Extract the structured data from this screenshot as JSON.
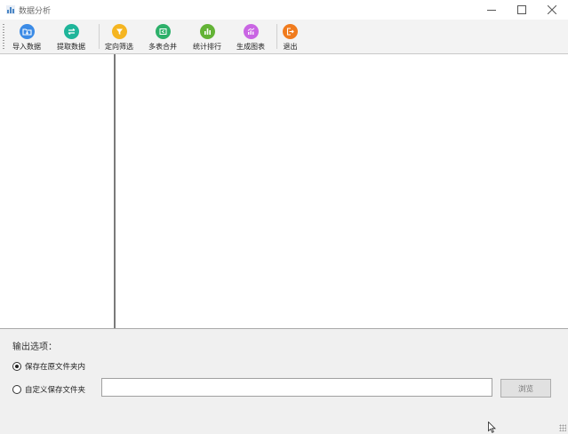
{
  "window": {
    "title": "数据分析",
    "app_icon": "bar-chart-icon"
  },
  "toolbar": {
    "items": [
      {
        "label": "导入数据",
        "icon": "import-folder-icon",
        "color": "#3b8be6"
      },
      {
        "label": "提取数据",
        "icon": "extract-swap-icon",
        "color": "#1fb59a"
      },
      {
        "label": "定向筛选",
        "icon": "funnel-filter-icon",
        "color": "#f5b521"
      },
      {
        "label": "多表合并",
        "icon": "merge-tables-icon",
        "color": "#2db06a"
      },
      {
        "label": "统计排行",
        "icon": "bar-stats-icon",
        "color": "#63b336"
      },
      {
        "label": "生成图表",
        "icon": "chart-generate-icon",
        "color": "#c965e3"
      },
      {
        "label": "退出",
        "icon": "exit-door-icon",
        "color": "#f07b1d"
      }
    ]
  },
  "output": {
    "section_label": "输出选项：",
    "option_original": "保存在原文件夹内",
    "option_custom": "自定义保存文件夹",
    "selected": "option_original",
    "path_value": "",
    "browse_label": "浏览"
  }
}
